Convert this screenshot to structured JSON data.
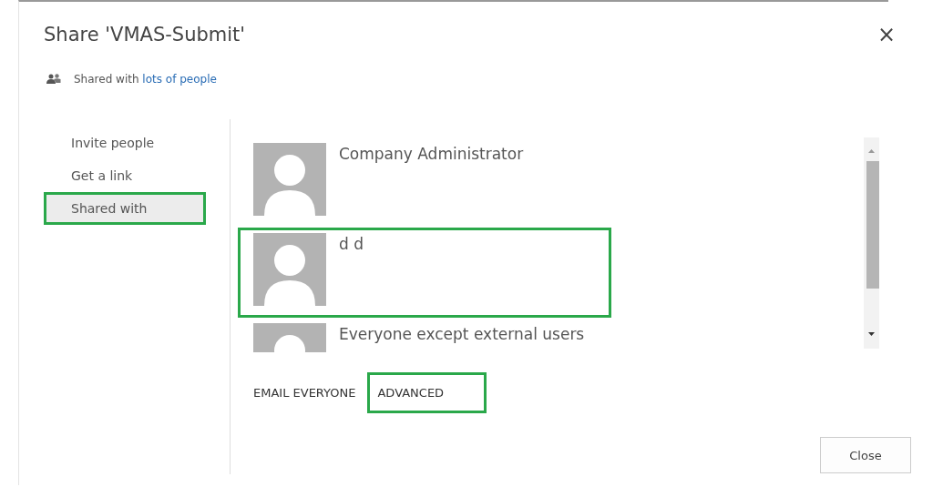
{
  "dialog": {
    "title": "Share 'VMAS-Submit'",
    "close_glyph": "×"
  },
  "shared_summary": {
    "text": "Shared with",
    "link": "lots of people"
  },
  "nav": [
    {
      "label": "Invite people",
      "selected": false,
      "highlighted": false
    },
    {
      "label": "Get a link",
      "selected": false,
      "highlighted": false
    },
    {
      "label": "Shared with",
      "selected": true,
      "highlighted": true
    }
  ],
  "people": [
    {
      "name": "Company Administrator",
      "highlighted": false
    },
    {
      "name": "d d",
      "highlighted": true
    },
    {
      "name": "Everyone except external users",
      "highlighted": false
    }
  ],
  "actions": [
    {
      "label": "EMAIL EVERYONE",
      "highlighted": false
    },
    {
      "label": "ADVANCED",
      "highlighted": true
    }
  ],
  "footer": {
    "button": "Close"
  }
}
